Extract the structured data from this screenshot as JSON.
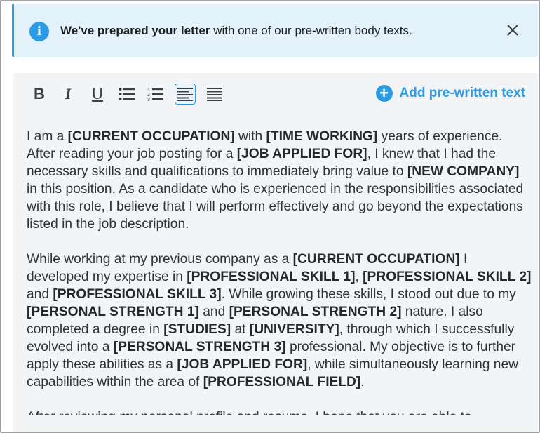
{
  "alert": {
    "bold_text": "We've prepared your letter",
    "text": " with one of our pre-written body texts.",
    "icon": "info-icon",
    "close_icon": "close-icon"
  },
  "toolbar": {
    "bold": "B",
    "italic": "I",
    "underline": "U",
    "add_label": "Add pre-written text",
    "add_icon": "+",
    "active_tool": "align-left"
  },
  "colors": {
    "accent": "#2b9be6",
    "alert_bg": "#e3f1fb",
    "editor_bg": "#f3f4f5"
  },
  "paragraphs": [
    [
      {
        "t": "I am a "
      },
      {
        "t": "[CURRENT OCCUPATION]",
        "b": true
      },
      {
        "t": " with "
      },
      {
        "t": "[TIME WORKING]",
        "b": true
      },
      {
        "t": " years of experience. After reading your job posting for a "
      },
      {
        "t": "[JOB APPLIED FOR]",
        "b": true
      },
      {
        "t": ", I knew that I had the necessary skills and qualifications to immediately bring value to "
      },
      {
        "t": "[NEW COMPANY]",
        "b": true
      },
      {
        "t": " in this position. As a candidate who is experienced in the responsibilities associated with this role, I believe that I will perform effectively and go beyond the expectations listed in the job description."
      }
    ],
    [
      {
        "t": "While working at my previous company as a "
      },
      {
        "t": "[CURRENT OCCUPATION]",
        "b": true
      },
      {
        "t": " I developed my expertise in "
      },
      {
        "t": "[PROFESSIONAL SKILL 1]",
        "b": true
      },
      {
        "t": ", "
      },
      {
        "t": "[PROFESSIONAL SKILL 2]",
        "b": true
      },
      {
        "t": " and "
      },
      {
        "t": "[PROFESSIONAL SKILL 3]",
        "b": true
      },
      {
        "t": ". While growing these skills, I stood out due to my "
      },
      {
        "t": "[PERSONAL STRENGTH 1]",
        "b": true
      },
      {
        "t": " and "
      },
      {
        "t": "[PERSONAL STRENGTH 2]",
        "b": true
      },
      {
        "t": " nature. I also completed a degree in "
      },
      {
        "t": "[STUDIES]",
        "b": true
      },
      {
        "t": " at "
      },
      {
        "t": "[UNIVERSITY]",
        "b": true
      },
      {
        "t": ", through which I successfully evolved into a "
      },
      {
        "t": "[PERSONAL STRENGTH 3]",
        "b": true
      },
      {
        "t": " professional. My objective is to further apply these abilities as a "
      },
      {
        "t": "[JOB APPLIED FOR]",
        "b": true
      },
      {
        "t": ", while simultaneously learning new capabilities within the area of "
      },
      {
        "t": "[PROFESSIONAL FIELD]",
        "b": true
      },
      {
        "t": "."
      }
    ],
    [
      {
        "t": "After reviewing my personal profile and resume, I hope that you are able to"
      }
    ]
  ]
}
